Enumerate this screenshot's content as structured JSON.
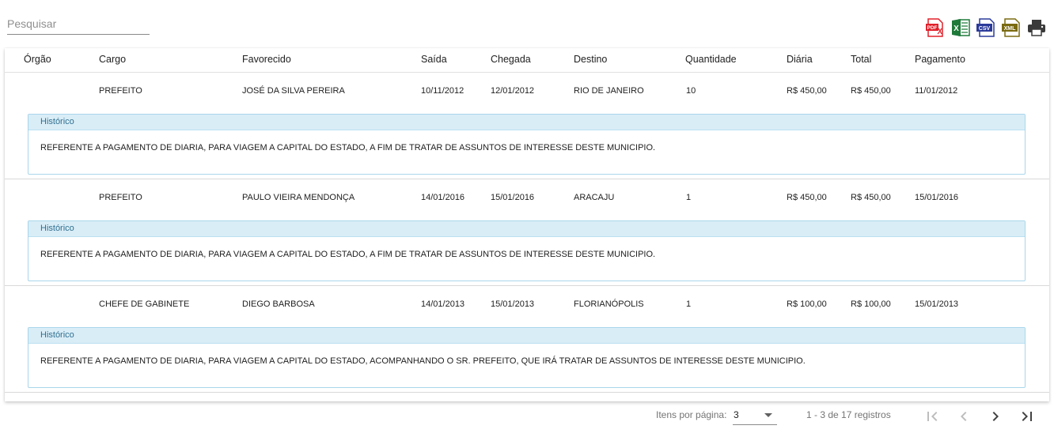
{
  "search": {
    "placeholder": "Pesquisar",
    "value": ""
  },
  "export": {
    "buttons": [
      {
        "label": "PDF",
        "icon": "pdf-icon",
        "color": "#e0202a"
      },
      {
        "label": "X",
        "icon": "excel-icon",
        "color": "#1f7a3a"
      },
      {
        "label": "CSV",
        "icon": "csv-icon",
        "color": "#2b3b9a"
      },
      {
        "label": "XML",
        "icon": "xml-icon",
        "color": "#7a6a10"
      },
      {
        "label": "",
        "icon": "print-icon",
        "color": "#3a3a3a"
      }
    ]
  },
  "table": {
    "columns": [
      "Órgão",
      "Cargo",
      "Favorecido",
      "Saída",
      "Chegada",
      "Destino",
      "Quantidade",
      "Diária",
      "Total",
      "Pagamento"
    ],
    "rows": [
      {
        "orgao": "",
        "cargo": "PREFEITO",
        "favorecido": "JOSÉ DA SILVA PEREIRA",
        "saida": "10/11/2012",
        "chegada": "12/01/2012",
        "destino": "RIO DE JANEIRO",
        "quantidade": "10",
        "diaria": "R$ 450,00",
        "total": "R$ 450,00",
        "pagamento": "11/01/2012",
        "historico_title": "Histórico",
        "historico": "REFERENTE A PAGAMENTO DE DIARIA, PARA VIAGEM A CAPITAL DO ESTADO, A FIM DE TRATAR DE ASSUNTOS DE INTERESSE DESTE MUNICIPIO."
      },
      {
        "orgao": "",
        "cargo": "PREFEITO",
        "favorecido": "PAULO VIEIRA MENDONÇA",
        "saida": "14/01/2016",
        "chegada": "15/01/2016",
        "destino": "ARACAJU",
        "quantidade": "1",
        "diaria": "R$ 450,00",
        "total": "R$ 450,00",
        "pagamento": "15/01/2016",
        "historico_title": "Histórico",
        "historico": "REFERENTE A PAGAMENTO DE DIARIA, PARA VIAGEM A CAPITAL DO ESTADO, A FIM DE TRATAR DE ASSUNTOS DE INTERESSE DESTE MUNICIPIO."
      },
      {
        "orgao": "",
        "cargo": "CHEFE DE GABINETE",
        "favorecido": "DIEGO BARBOSA",
        "saida": "14/01/2013",
        "chegada": "15/01/2013",
        "destino": "FLORIANÓPOLIS",
        "quantidade": "1",
        "diaria": "R$ 100,00",
        "total": "R$ 100,00",
        "pagamento": "15/01/2013",
        "historico_title": "Histórico",
        "historico": "REFERENTE A PAGAMENTO DE DIARIA, PARA VIAGEM A CAPITAL DO ESTADO, ACOMPANHANDO O SR. PREFEITO, QUE IRÁ TRATAR DE ASSUNTOS DE INTERESSE DESTE MUNICIPIO."
      }
    ]
  },
  "paginator": {
    "items_per_page_label": "Itens por página:",
    "items_per_page": "3",
    "range_label": "1 - 3 de 17 registros",
    "icons": [
      "first-page-icon",
      "previous-page-icon",
      "next-page-icon",
      "last-page-icon"
    ]
  }
}
